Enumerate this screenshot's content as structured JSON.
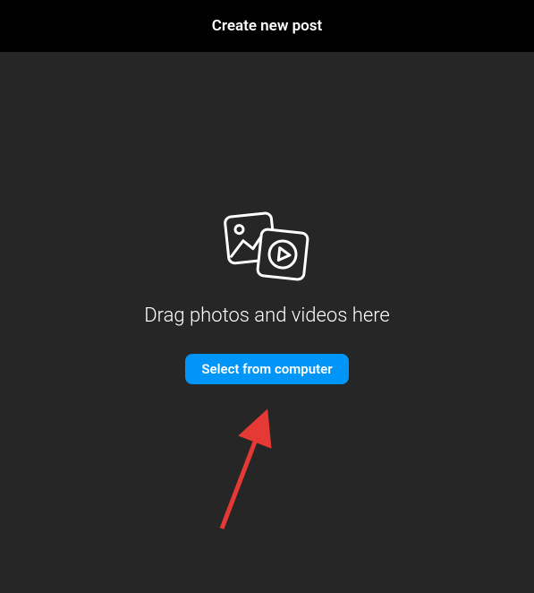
{
  "header": {
    "title": "Create new post"
  },
  "content": {
    "instruction": "Drag photos and videos here",
    "button_label": "Select from computer"
  },
  "colors": {
    "accent": "#0095f6",
    "background": "#262626",
    "header_bg": "#000000",
    "annotation": "#e53935"
  }
}
